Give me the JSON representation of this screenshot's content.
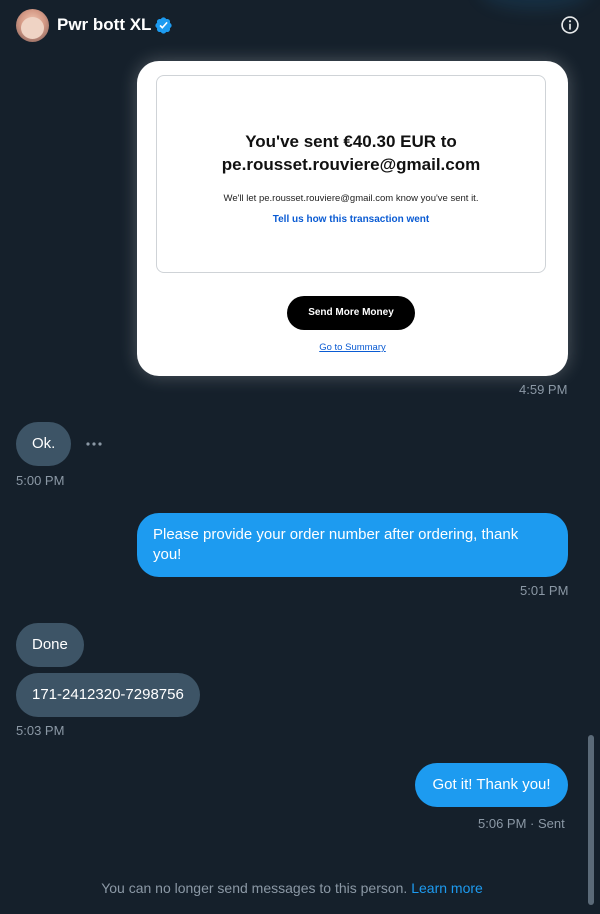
{
  "header": {
    "title": "Pwr bott XL",
    "avatar_icon": "avatar",
    "verified_icon": "verified-badge-icon",
    "info_icon": "info-icon"
  },
  "card": {
    "heading_line1": "You've sent €40.30 EUR to",
    "heading_line2": "pe.rousset.rouviere@gmail.com",
    "subtext": "We'll let pe.rousset.rouviere@gmail.com know you've sent it.",
    "feedback_link": "Tell us how this transaction went",
    "send_more_button": "Send More Money",
    "summary_link": "Go to Summary"
  },
  "messages": [
    {
      "direction": "out",
      "type": "card",
      "time": "4:59 PM"
    },
    {
      "direction": "in",
      "text": "Ok.",
      "time": "5:00 PM"
    },
    {
      "direction": "out",
      "text_line1": "Please provide your order number after ordering, thank",
      "text_line2": "you!",
      "time": "5:01 PM"
    },
    {
      "direction": "in",
      "text": "Done"
    },
    {
      "direction": "in",
      "text": "171-2412320-7298756",
      "time": "5:03 PM"
    },
    {
      "direction": "out",
      "text": "Got it! Thank you!",
      "time": "5:06 PM · Sent"
    }
  ],
  "footer": {
    "note": "You can no longer send messages to this person.",
    "link": "Learn more"
  },
  "colors": {
    "background": "#15202b",
    "incoming_bubble": "#3d5466",
    "outgoing_bubble": "#1d9bf0",
    "accent": "#1d9bf0",
    "muted_text": "#8b98a5"
  }
}
